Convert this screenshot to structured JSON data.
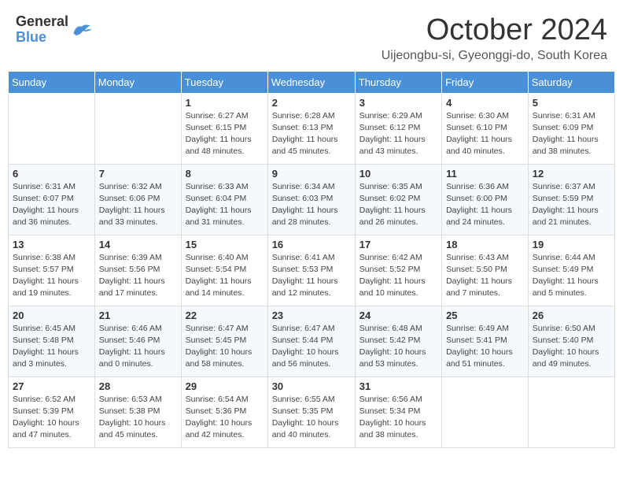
{
  "header": {
    "logo_general": "General",
    "logo_blue": "Blue",
    "month_title": "October 2024",
    "location": "Uijeongbu-si, Gyeonggi-do, South Korea"
  },
  "days_of_week": [
    "Sunday",
    "Monday",
    "Tuesday",
    "Wednesday",
    "Thursday",
    "Friday",
    "Saturday"
  ],
  "weeks": [
    [
      {
        "day": "",
        "info": ""
      },
      {
        "day": "",
        "info": ""
      },
      {
        "day": "1",
        "info": "Sunrise: 6:27 AM\nSunset: 6:15 PM\nDaylight: 11 hours and 48 minutes."
      },
      {
        "day": "2",
        "info": "Sunrise: 6:28 AM\nSunset: 6:13 PM\nDaylight: 11 hours and 45 minutes."
      },
      {
        "day": "3",
        "info": "Sunrise: 6:29 AM\nSunset: 6:12 PM\nDaylight: 11 hours and 43 minutes."
      },
      {
        "day": "4",
        "info": "Sunrise: 6:30 AM\nSunset: 6:10 PM\nDaylight: 11 hours and 40 minutes."
      },
      {
        "day": "5",
        "info": "Sunrise: 6:31 AM\nSunset: 6:09 PM\nDaylight: 11 hours and 38 minutes."
      }
    ],
    [
      {
        "day": "6",
        "info": "Sunrise: 6:31 AM\nSunset: 6:07 PM\nDaylight: 11 hours and 36 minutes."
      },
      {
        "day": "7",
        "info": "Sunrise: 6:32 AM\nSunset: 6:06 PM\nDaylight: 11 hours and 33 minutes."
      },
      {
        "day": "8",
        "info": "Sunrise: 6:33 AM\nSunset: 6:04 PM\nDaylight: 11 hours and 31 minutes."
      },
      {
        "day": "9",
        "info": "Sunrise: 6:34 AM\nSunset: 6:03 PM\nDaylight: 11 hours and 28 minutes."
      },
      {
        "day": "10",
        "info": "Sunrise: 6:35 AM\nSunset: 6:02 PM\nDaylight: 11 hours and 26 minutes."
      },
      {
        "day": "11",
        "info": "Sunrise: 6:36 AM\nSunset: 6:00 PM\nDaylight: 11 hours and 24 minutes."
      },
      {
        "day": "12",
        "info": "Sunrise: 6:37 AM\nSunset: 5:59 PM\nDaylight: 11 hours and 21 minutes."
      }
    ],
    [
      {
        "day": "13",
        "info": "Sunrise: 6:38 AM\nSunset: 5:57 PM\nDaylight: 11 hours and 19 minutes."
      },
      {
        "day": "14",
        "info": "Sunrise: 6:39 AM\nSunset: 5:56 PM\nDaylight: 11 hours and 17 minutes."
      },
      {
        "day": "15",
        "info": "Sunrise: 6:40 AM\nSunset: 5:54 PM\nDaylight: 11 hours and 14 minutes."
      },
      {
        "day": "16",
        "info": "Sunrise: 6:41 AM\nSunset: 5:53 PM\nDaylight: 11 hours and 12 minutes."
      },
      {
        "day": "17",
        "info": "Sunrise: 6:42 AM\nSunset: 5:52 PM\nDaylight: 11 hours and 10 minutes."
      },
      {
        "day": "18",
        "info": "Sunrise: 6:43 AM\nSunset: 5:50 PM\nDaylight: 11 hours and 7 minutes."
      },
      {
        "day": "19",
        "info": "Sunrise: 6:44 AM\nSunset: 5:49 PM\nDaylight: 11 hours and 5 minutes."
      }
    ],
    [
      {
        "day": "20",
        "info": "Sunrise: 6:45 AM\nSunset: 5:48 PM\nDaylight: 11 hours and 3 minutes."
      },
      {
        "day": "21",
        "info": "Sunrise: 6:46 AM\nSunset: 5:46 PM\nDaylight: 11 hours and 0 minutes."
      },
      {
        "day": "22",
        "info": "Sunrise: 6:47 AM\nSunset: 5:45 PM\nDaylight: 10 hours and 58 minutes."
      },
      {
        "day": "23",
        "info": "Sunrise: 6:47 AM\nSunset: 5:44 PM\nDaylight: 10 hours and 56 minutes."
      },
      {
        "day": "24",
        "info": "Sunrise: 6:48 AM\nSunset: 5:42 PM\nDaylight: 10 hours and 53 minutes."
      },
      {
        "day": "25",
        "info": "Sunrise: 6:49 AM\nSunset: 5:41 PM\nDaylight: 10 hours and 51 minutes."
      },
      {
        "day": "26",
        "info": "Sunrise: 6:50 AM\nSunset: 5:40 PM\nDaylight: 10 hours and 49 minutes."
      }
    ],
    [
      {
        "day": "27",
        "info": "Sunrise: 6:52 AM\nSunset: 5:39 PM\nDaylight: 10 hours and 47 minutes."
      },
      {
        "day": "28",
        "info": "Sunrise: 6:53 AM\nSunset: 5:38 PM\nDaylight: 10 hours and 45 minutes."
      },
      {
        "day": "29",
        "info": "Sunrise: 6:54 AM\nSunset: 5:36 PM\nDaylight: 10 hours and 42 minutes."
      },
      {
        "day": "30",
        "info": "Sunrise: 6:55 AM\nSunset: 5:35 PM\nDaylight: 10 hours and 40 minutes."
      },
      {
        "day": "31",
        "info": "Sunrise: 6:56 AM\nSunset: 5:34 PM\nDaylight: 10 hours and 38 minutes."
      },
      {
        "day": "",
        "info": ""
      },
      {
        "day": "",
        "info": ""
      }
    ]
  ]
}
